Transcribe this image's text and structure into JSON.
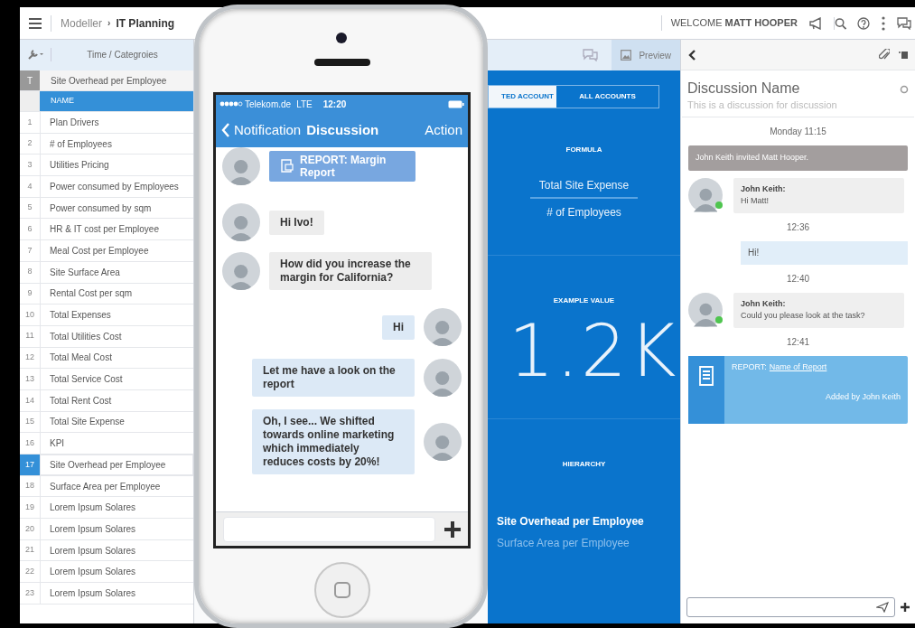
{
  "top_bar": {
    "breadcrumb": [
      {
        "label": "Modeller",
        "current": false
      },
      {
        "label": "IT Planning",
        "current": true
      }
    ],
    "separator": "›",
    "welcome": "WELCOME **MATT HOOPER**"
  },
  "grid": {
    "toolbar_label": "Time / Categroies",
    "title_row": {
      "marker": "T",
      "name": "Site Overhead per Employee"
    },
    "column": "NAME",
    "rows": [
      {
        "number": "1",
        "name": "Plan Drivers",
        "selected": false
      },
      {
        "number": "2",
        "name": "# of Employees",
        "selected": false
      },
      {
        "number": "3",
        "name": "Utilities Pricing",
        "selected": false
      },
      {
        "number": "4",
        "name": "Power consumed by Employees",
        "selected": false
      },
      {
        "number": "5",
        "name": "Power consumed by sqm",
        "selected": false
      },
      {
        "number": "6",
        "name": "HR & IT cost per Employee",
        "selected": false
      },
      {
        "number": "7",
        "name": "Meal Cost per Employee",
        "selected": false
      },
      {
        "number": "8",
        "name": "Site Surface Area",
        "selected": false
      },
      {
        "number": "9",
        "name": "Rental Cost per sqm",
        "selected": false
      },
      {
        "number": "10",
        "name": "Total Expenses",
        "selected": false
      },
      {
        "number": "11",
        "name": "Total Utilities Cost",
        "selected": false
      },
      {
        "number": "12",
        "name": "Total Meal Cost",
        "selected": false
      },
      {
        "number": "13",
        "name": "Total Service Cost",
        "selected": false
      },
      {
        "number": "14",
        "name": "Total Rent Cost",
        "selected": false
      },
      {
        "number": "15",
        "name": "Total Site Expense",
        "selected": false
      },
      {
        "number": "16",
        "name": "KPI",
        "selected": false
      },
      {
        "number": "17",
        "name": "Site Overhead per Employee",
        "selected": true
      },
      {
        "number": "18",
        "name": "Surface Area per Employee",
        "selected": false
      },
      {
        "number": "19",
        "name": "Lorem Ipsum Solares",
        "selected": false
      },
      {
        "number": "20",
        "name": "Lorem Ipsum Solares",
        "selected": false
      },
      {
        "number": "21",
        "name": "Lorem Ipsum Solares",
        "selected": false
      },
      {
        "number": "22",
        "name": "Lorem Ipsum Solares",
        "selected": false
      },
      {
        "number": "23",
        "name": "Lorem Ipsum Solares",
        "selected": false
      }
    ]
  },
  "details": {
    "preview": "Preview",
    "account_tabs": [
      {
        "label": "TED ACCOUNT",
        "selected": true
      },
      {
        "label": "ALL ACCOUNTS",
        "selected": false
      }
    ],
    "formula": {
      "heading": "FORMULA",
      "numerator": "Total Site Expense",
      "denominator": "# of Employees"
    },
    "example": {
      "heading": "EXAMPLE VALUE",
      "value": "1.2K"
    },
    "hierarchy": {
      "heading": "HIERARCHY",
      "items": [
        {
          "label": "Site Overhead per Employee",
          "selected": true
        },
        {
          "label": "Surface Area per Employee",
          "selected": false
        }
      ]
    }
  },
  "discussion": {
    "title": "Discussion Name",
    "subtitle": "This is a discussion for discussion",
    "items": [
      {
        "kind": "time",
        "text": "Monday 11:15"
      },
      {
        "kind": "system",
        "text": "John Keith invited Matt Hooper."
      },
      {
        "kind": "message",
        "author": "John Keith:",
        "text": "Hi Matt!",
        "outgoing": false,
        "online": true
      },
      {
        "kind": "time",
        "text": "12:36"
      },
      {
        "kind": "message",
        "text": "Hi!",
        "outgoing": true
      },
      {
        "kind": "time",
        "text": "12:40"
      },
      {
        "kind": "message",
        "author": "John Keith:",
        "text": "Could you please look at the task?",
        "outgoing": false,
        "online": true
      },
      {
        "kind": "time",
        "text": "12:41"
      },
      {
        "kind": "report",
        "label": "REPORT:",
        "link": "Name of Report",
        "footer": "Added by John Keith"
      }
    ]
  },
  "phone": {
    "status": {
      "carrier": "Telekom.de",
      "network": "LTE",
      "time": "12:20"
    },
    "nav": {
      "back": "Notification",
      "title": "Discussion",
      "action": "Action"
    },
    "messages": [
      {
        "kind": "report",
        "outgoing": false,
        "text": "REPORT: Margin Report"
      },
      {
        "kind": "text",
        "outgoing": false,
        "text": "Hi Ivo!"
      },
      {
        "kind": "text",
        "outgoing": false,
        "text": "How did you increase the margin for California?"
      },
      {
        "kind": "text",
        "outgoing": true,
        "text": "Hi"
      },
      {
        "kind": "text",
        "outgoing": true,
        "text": "Let me have a look on the report"
      },
      {
        "kind": "text",
        "outgoing": true,
        "text": "Oh, I see... We shifted towards online marketing which immediately reduces costs by 20%!"
      }
    ]
  }
}
